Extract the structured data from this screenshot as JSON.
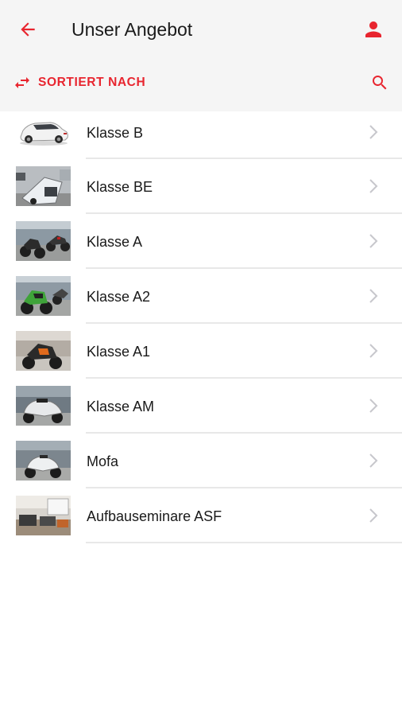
{
  "header": {
    "title": "Unser Angebot",
    "back_icon": "arrow-left-icon",
    "profile_icon": "person-icon"
  },
  "toolbar": {
    "sort_label": "SORTIERT NACH",
    "sort_icon": "swap-horizontal-icon",
    "search_icon": "search-icon"
  },
  "colors": {
    "accent": "#e8252f",
    "header_bg": "#f5f5f5",
    "text": "#1a1a1a",
    "chevron": "#c7c7cc",
    "divider": "#e8e8e8"
  },
  "items": [
    {
      "label": "Klasse B",
      "image": "car-thumbnail"
    },
    {
      "label": "Klasse BE",
      "image": "trailer-thumbnail"
    },
    {
      "label": "Klasse A",
      "image": "motorcycles-thumbnail"
    },
    {
      "label": "Klasse A2",
      "image": "motorcycle-green-thumbnail"
    },
    {
      "label": "Klasse A1",
      "image": "motorcycle-orange-thumbnail"
    },
    {
      "label": "Klasse AM",
      "image": "scooter-thumbnail"
    },
    {
      "label": "Mofa",
      "image": "moped-thumbnail"
    },
    {
      "label": "Aufbauseminare ASF",
      "image": "classroom-thumbnail"
    }
  ]
}
